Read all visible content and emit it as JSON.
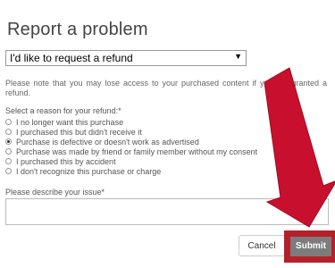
{
  "dialog": {
    "title": "Report a problem",
    "problem_select": {
      "value": "I'd like to request a refund"
    },
    "notice": "Please note that you may lose access to your purchased content if you are granted a refund.",
    "reason_label": "Select a reason for your refund:*",
    "reasons": [
      {
        "label": "I no longer want this purchase",
        "selected": false
      },
      {
        "label": "I purchased this but didn't receive it",
        "selected": false
      },
      {
        "label": "Purchase is defective or doesn't work as advertised",
        "selected": true
      },
      {
        "label": "Purchase was made by friend or family member without my consent",
        "selected": false
      },
      {
        "label": "I purchased this by accident",
        "selected": false
      },
      {
        "label": "I don't recognize this purchase or charge",
        "selected": false
      }
    ],
    "description_label": "Please describe your issue*",
    "description_value": "",
    "cancel_label": "Cancel",
    "submit_label": "Submit"
  },
  "colors": {
    "annotation_arrow": "#c8102e",
    "highlight_box": "#b5202b",
    "submit_button": "#7c7c7c"
  }
}
